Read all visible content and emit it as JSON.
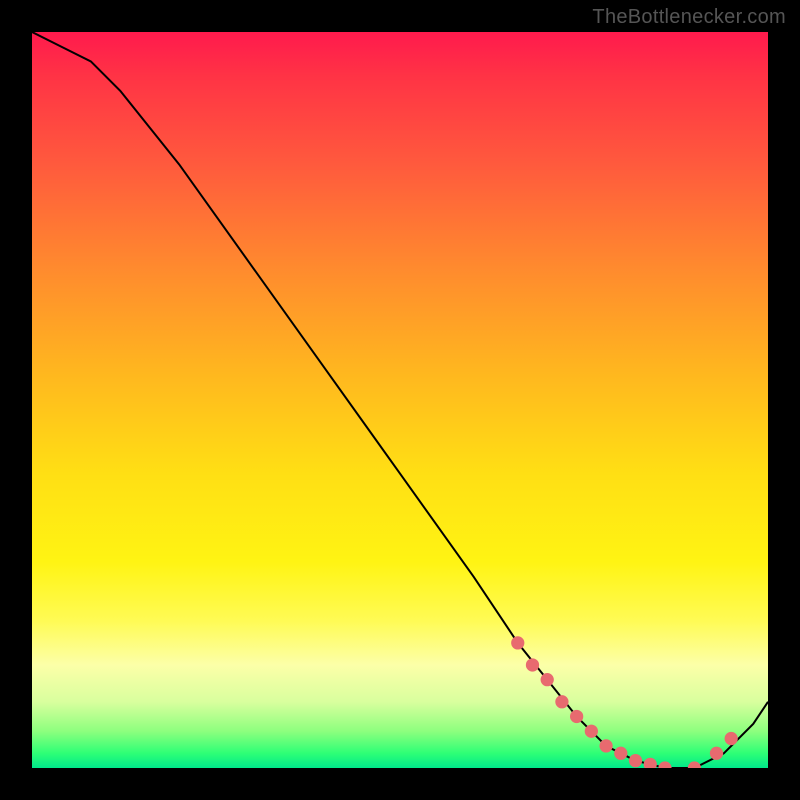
{
  "watermark": "TheBottlenecker.com",
  "chart_data": {
    "type": "line",
    "title": "",
    "xlabel": "",
    "ylabel": "",
    "xlim": [
      0,
      100
    ],
    "ylim": [
      0,
      100
    ],
    "series": [
      {
        "name": "curve",
        "x": [
          0,
          4,
          8,
          12,
          20,
          30,
          40,
          50,
          60,
          66,
          70,
          74,
          78,
          82,
          86,
          90,
          94,
          98,
          100
        ],
        "y": [
          100,
          98,
          96,
          92,
          82,
          68,
          54,
          40,
          26,
          17,
          12,
          7,
          3,
          1,
          0,
          0,
          2,
          6,
          9
        ]
      }
    ],
    "markers": {
      "name": "dots",
      "x": [
        66,
        68,
        70,
        72,
        74,
        76,
        78,
        80,
        82,
        84,
        86,
        90,
        93,
        95
      ],
      "y": [
        17,
        14,
        12,
        9,
        7,
        5,
        3,
        2,
        1,
        0.5,
        0,
        0,
        2,
        4
      ],
      "color": "#e86a6f",
      "size": 7
    },
    "background_gradient_note": "vertical gradient red→yellow→green across plot area"
  }
}
